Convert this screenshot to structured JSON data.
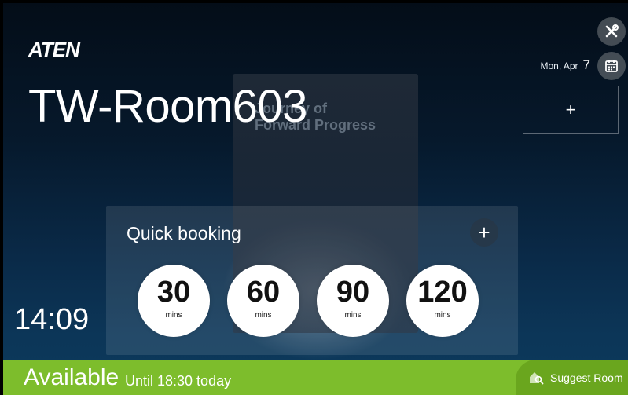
{
  "brand": {
    "logo_text": "ATEN"
  },
  "background": {
    "book_text": "Journey of\nForward Progress"
  },
  "room": {
    "name": "TW-Room603"
  },
  "header": {
    "date_day": "Mon,  Apr",
    "date_num": "7",
    "tools_icon": "tools-icon",
    "calendar_icon": "calendar-icon"
  },
  "add_box": {
    "label": "+"
  },
  "quick_booking": {
    "title": "Quick booking",
    "add_label": "+",
    "options": [
      {
        "value": "30",
        "unit": "mins"
      },
      {
        "value": "60",
        "unit": "mins"
      },
      {
        "value": "90",
        "unit": "mins"
      },
      {
        "value": "120",
        "unit": "mins"
      }
    ]
  },
  "clock": {
    "time": "14:09"
  },
  "status": {
    "state": "Available",
    "detail": "Until 18:30 today",
    "color": "#7dbd2c"
  },
  "suggest": {
    "label": "Suggest Room",
    "icon": "suggest-room-icon"
  }
}
